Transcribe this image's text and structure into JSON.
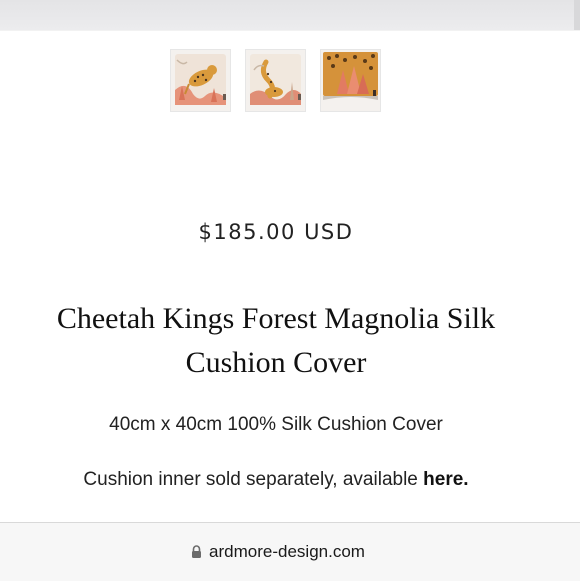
{
  "gallery": {
    "thumbnails": [
      {
        "alt": "cheetah-cushion-front-icon"
      },
      {
        "alt": "cheetah-cushion-back-icon"
      },
      {
        "alt": "cheetah-cushion-detail-icon"
      }
    ]
  },
  "product": {
    "price": "$185.00 USD",
    "title": "Cheetah Kings Forest Magnolia Silk Cushion Cover",
    "subtitle": "40cm x 40cm 100% Silk Cushion Cover",
    "note_text": "Cushion inner sold separately, available ",
    "note_link": "here."
  },
  "browser": {
    "url": "ardmore-design.com",
    "lock_icon": "lock-icon"
  },
  "colors": {
    "background": "#ffffff",
    "url_bar": "#f7f7f7",
    "text": "#1c1c1c",
    "cushion_cream": "#efe6dc",
    "cheetah_gold": "#d99a3c",
    "coral": "#e28b72"
  }
}
